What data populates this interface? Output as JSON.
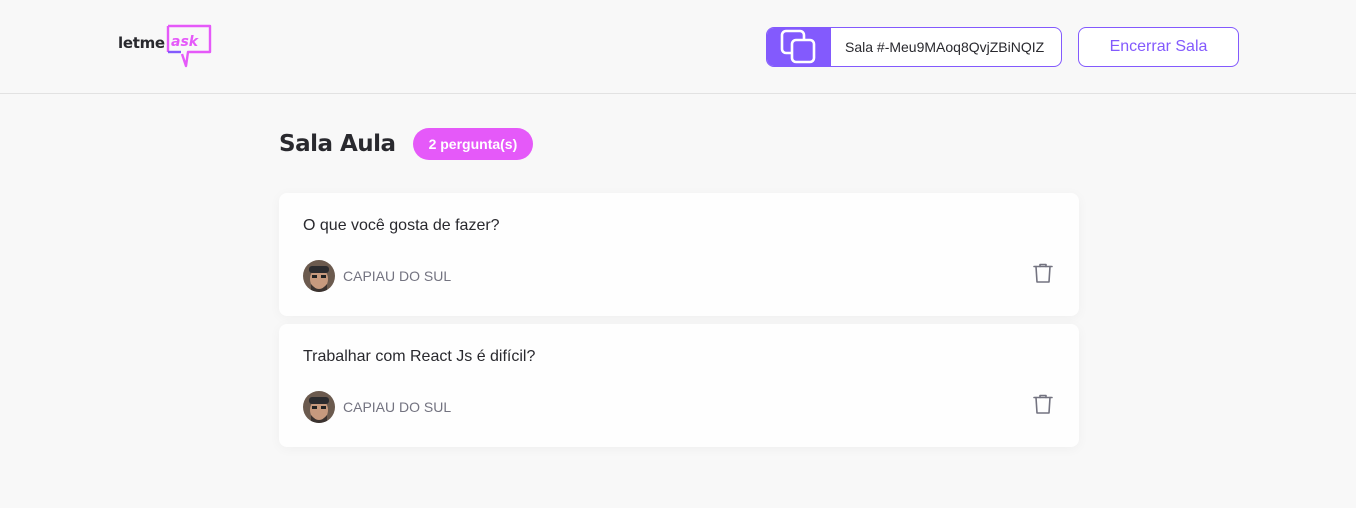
{
  "header": {
    "logo": {
      "part1": "letme",
      "part2": "ask"
    },
    "room_code": {
      "label": "Sala #-Meu9MAoq8QvjZBiNQIZ",
      "icon": "copy-icon"
    },
    "end_button_label": "Encerrar Sala"
  },
  "main": {
    "title": "Sala Aula",
    "question_count_badge": "2 pergunta(s)",
    "questions": [
      {
        "content": "O que você gosta de fazer?",
        "author": "CAPIAU DO SUL",
        "action_icon": "trash-icon"
      },
      {
        "content": "Trabalhar com React Js é difícil?",
        "author": "CAPIAU DO SUL",
        "action_icon": "trash-icon"
      }
    ]
  },
  "colors": {
    "primary": "#835afd",
    "accent": "#e559f9",
    "background": "#f8f8f8",
    "text": "#29292e",
    "muted": "#737380"
  }
}
